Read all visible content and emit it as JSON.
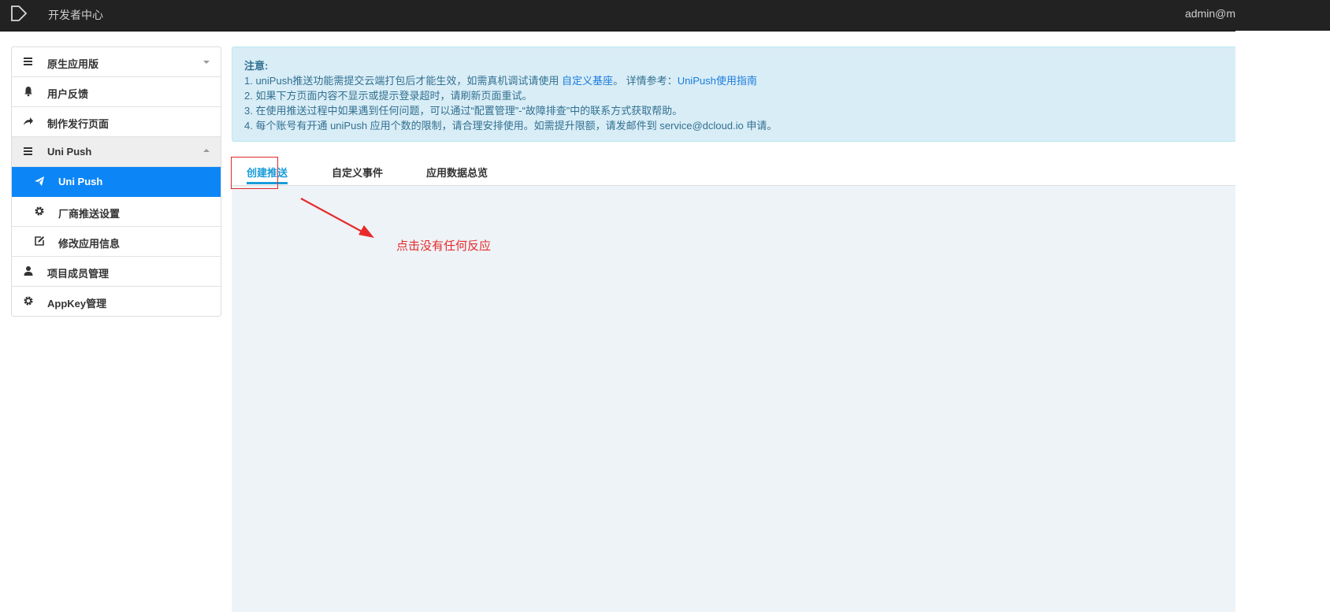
{
  "topbar": {
    "brand": "开发者中心",
    "user": "admin@mi"
  },
  "sidebar": {
    "items": [
      {
        "label": "原生应用版",
        "icon": "list-icon"
      },
      {
        "label": "用户反馈",
        "icon": "bell-icon"
      },
      {
        "label": "制作发行页面",
        "icon": "share-icon"
      },
      {
        "label": "Uni Push",
        "icon": "list-icon"
      },
      {
        "label": "Uni Push",
        "icon": "send-icon"
      },
      {
        "label": "厂商推送设置",
        "icon": "gear-icon"
      },
      {
        "label": "修改应用信息",
        "icon": "edit-icon"
      },
      {
        "label": "项目成员管理",
        "icon": "user-icon"
      },
      {
        "label": "AppKey管理",
        "icon": "gear-icon"
      }
    ]
  },
  "notice": {
    "title": "注意:",
    "line1_pre": "1. uniPush推送功能需提交云端打包后才能生效，如需真机调试请使用 ",
    "line1_link1": "自定义基座",
    "line1_mid": "。 详情参考：",
    "line1_link2": "UniPush使用指南",
    "line2": "2. 如果下方页面内容不显示或提示登录超时，请刷新页面重试。",
    "line3": "3. 在使用推送过程中如果遇到任何问题，可以通过“配置管理”-“故障排查”中的联系方式获取帮助。",
    "line4": "4. 每个账号有开通 uniPush 应用个数的限制，请合理安排使用。如需提升限额，请发邮件到 service@dcloud.io 申请。"
  },
  "tabs": [
    {
      "label": "创建推送",
      "active": true
    },
    {
      "label": "自定义事件",
      "active": false
    },
    {
      "label": "应用数据总览",
      "active": false
    }
  ],
  "annotation": {
    "text": "点击没有任何反应",
    "color": "#e62b2b"
  },
  "colors": {
    "accent": "#0c86f7",
    "tab_active": "#1a9cd9",
    "topbar": "#222222",
    "notice_bg": "#d9edf7"
  }
}
